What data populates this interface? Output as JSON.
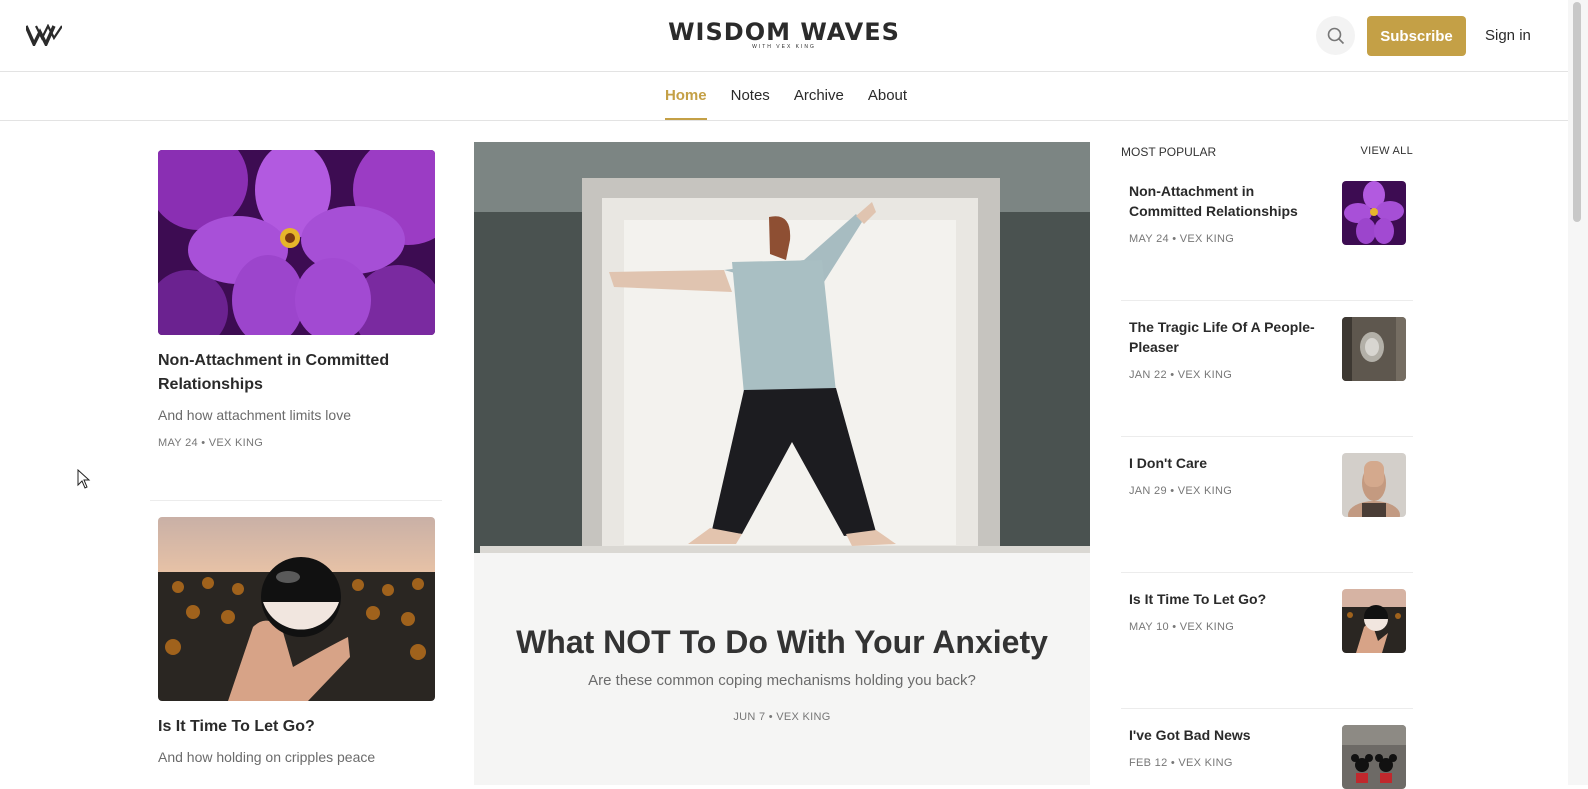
{
  "header": {
    "brand_title": "WISDOM WAVES",
    "brand_subtitle": "WITH VEX KING",
    "subscribe_label": "Subscribe",
    "signin_label": "Sign in",
    "accent_color": "#c4a046"
  },
  "nav": {
    "items": [
      {
        "label": "Home",
        "active": true
      },
      {
        "label": "Notes"
      },
      {
        "label": "Archive"
      },
      {
        "label": "About"
      }
    ]
  },
  "left_cards": [
    {
      "title": "Non-Attachment in Committed Relationships",
      "subtitle": "And how attachment limits love",
      "meta": "MAY 24 • VEX KING",
      "image": "purple-flowers"
    },
    {
      "title": "Is It Time To Let Go?",
      "subtitle": "And how holding on cripples peace",
      "image": "crystal-ball-sunflowers"
    }
  ],
  "hero": {
    "title": "What NOT To Do With Your Anxiety",
    "subtitle": "Are these common coping mechanisms holding you back?",
    "meta": "JUN 7 • VEX KING",
    "image": "person-in-box"
  },
  "popular": {
    "heading": "MOST POPULAR",
    "view_all": "VIEW ALL",
    "items": [
      {
        "title": "Non-Attachment in Committed Relationships",
        "meta": "MAY 24 • VEX KING",
        "image": "purple-flowers"
      },
      {
        "title": "The Tragic Life Of A People-Pleaser",
        "meta": "JAN 22 • VEX KING",
        "image": "peephole-door"
      },
      {
        "title": "I Don't Care",
        "meta": "JAN 29 • VEX KING",
        "image": "hand-over-face"
      },
      {
        "title": "Is It Time To Let Go?",
        "meta": "MAY 10 • VEX KING",
        "image": "crystal-ball-sunflowers"
      },
      {
        "title": "I've Got Bad News",
        "meta": "FEB 12 • VEX KING",
        "image": "mickey-figures"
      }
    ]
  }
}
